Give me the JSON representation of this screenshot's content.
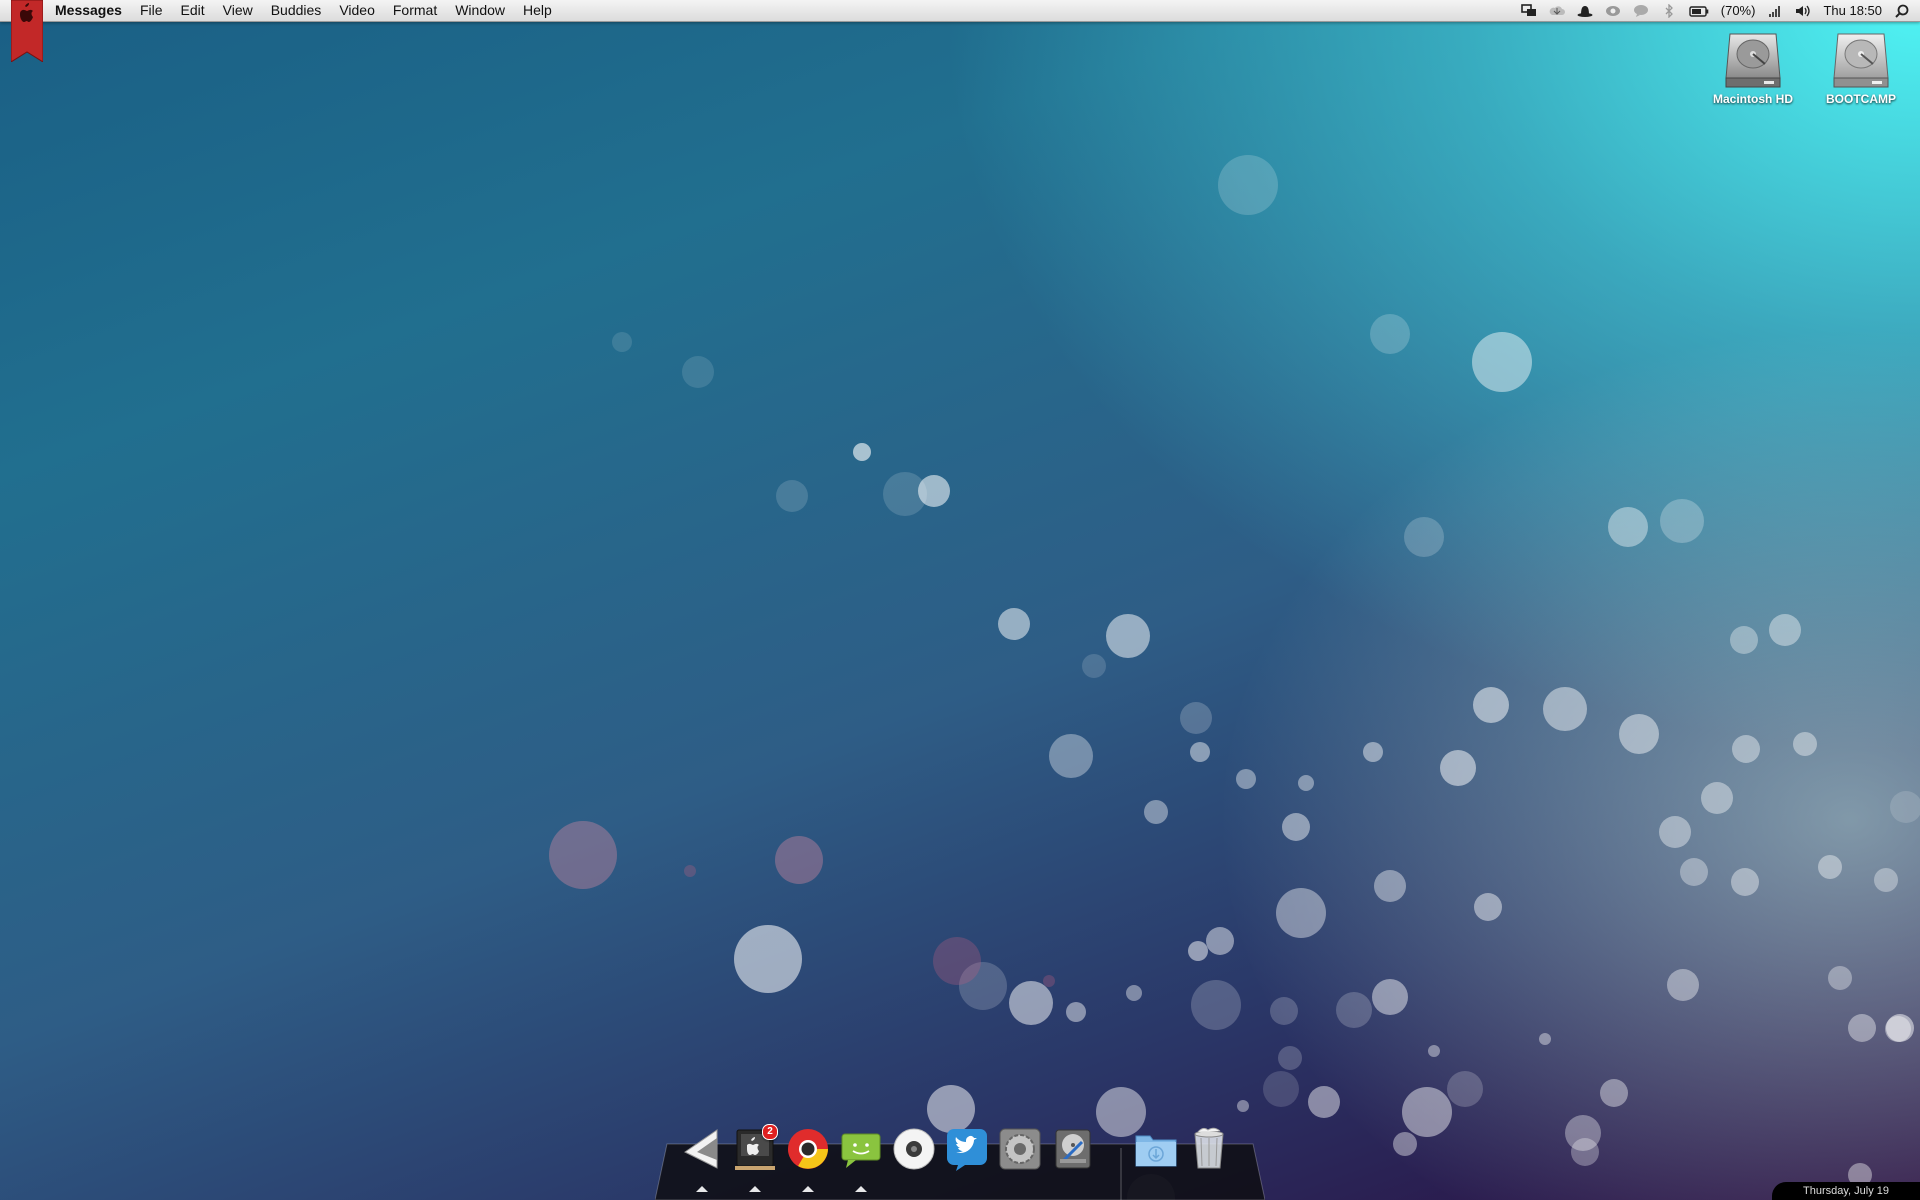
{
  "menubar": {
    "app_name": "Messages",
    "items": [
      "File",
      "Edit",
      "View",
      "Buddies",
      "Video",
      "Format",
      "Window",
      "Help"
    ],
    "status": {
      "battery_percent": "(70%)",
      "clock": "Thu 18:50",
      "icons": [
        "screen-mirroring-icon",
        "cloud-app-icon",
        "alfred-hat-icon",
        "eye-icon",
        "messages-status-icon",
        "bluetooth-icon",
        "battery-icon",
        "wifi-icon",
        "volume-icon",
        "spotlight-icon"
      ]
    }
  },
  "desktop": {
    "drives": [
      {
        "label": "Macintosh HD",
        "icon": "hard-drive-icon"
      },
      {
        "label": "BOOTCAMP",
        "icon": "hard-drive-icon"
      }
    ]
  },
  "dock": {
    "items": [
      {
        "name": "finder-icon",
        "running": true
      },
      {
        "name": "app-store-icon",
        "running": true,
        "badge": "2"
      },
      {
        "name": "chrome-browser-icon",
        "running": true
      },
      {
        "name": "messages-app-icon",
        "running": true
      },
      {
        "name": "itunes-icon",
        "running": false
      },
      {
        "name": "twitter-icon",
        "running": false
      },
      {
        "name": "system-preferences-icon",
        "running": false
      },
      {
        "name": "disk-utility-icon",
        "running": false
      }
    ],
    "stacks": [
      {
        "name": "downloads-folder-icon"
      },
      {
        "name": "trash-icon"
      }
    ]
  },
  "date_strip": "Thursday, July 19",
  "colors": {
    "menubar": "#e6e6e6",
    "ribbon": "#c92a2a",
    "wallpaper_dark": "#2b0d40",
    "wallpaper_light": "#50f5f5"
  }
}
